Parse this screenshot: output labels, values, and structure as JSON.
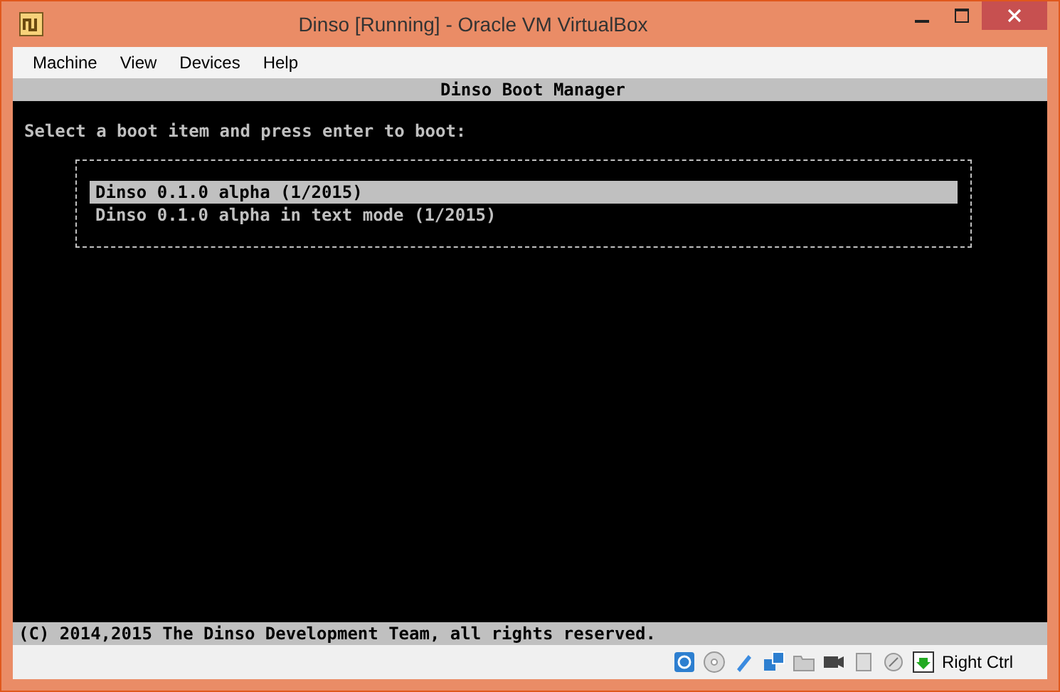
{
  "window": {
    "title": "Dinso [Running] - Oracle VM VirtualBox"
  },
  "menu": [
    "Machine",
    "View",
    "Devices",
    "Help"
  ],
  "console": {
    "header": "Dinso Boot Manager",
    "prompt": "Select a boot item and press enter to boot:",
    "items": [
      {
        "label": "Dinso 0.1.0 alpha (1/2015)",
        "selected": true
      },
      {
        "label": "Dinso 0.1.0 alpha in text mode (1/2015)",
        "selected": false
      }
    ],
    "footer": "(C) 2014,2015 The Dinso Development Team, all rights reserved."
  },
  "status_bar": {
    "host_key": "Right Ctrl"
  }
}
